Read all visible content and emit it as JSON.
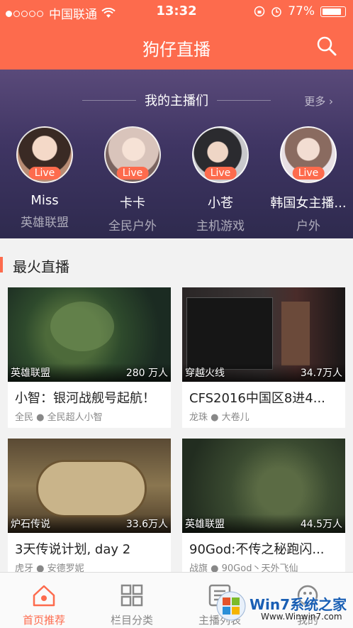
{
  "status_bar": {
    "carrier": "中国联通",
    "time": "13:32",
    "battery": "77%"
  },
  "header": {
    "title": "狗仔直播"
  },
  "my_anchors": {
    "title": "我的主播们",
    "more": "更多",
    "live_label": "Live",
    "items": [
      {
        "name": "Miss",
        "category": "英雄联盟"
      },
      {
        "name": "卡卡",
        "category": "全民户外"
      },
      {
        "name": "小苍",
        "category": "主机游戏"
      },
      {
        "name": "韩国女主播...",
        "category": "户外"
      }
    ]
  },
  "hot": {
    "title": "最火直播",
    "cards": [
      {
        "tag": "英雄联盟",
        "views": "280 万人",
        "title": "小智：银河战舰号起航！",
        "platform": "全民",
        "streamer": "全民超人小智"
      },
      {
        "tag": "穿越火线",
        "views": "34.7万人",
        "title": "CFS2016中国区8进4...",
        "platform": "龙珠",
        "streamer": "大卷儿"
      },
      {
        "tag": "炉石传说",
        "views": "33.6万人",
        "title": "3天传说计划, day 2",
        "platform": "虎牙",
        "streamer": "安德罗妮"
      },
      {
        "tag": "英雄联盟",
        "views": "44.5万人",
        "title": "90God:不传之秘跑闪...",
        "platform": "战旗",
        "streamer": "90God丶天外飞仙"
      }
    ]
  },
  "tabbar": {
    "items": [
      {
        "label": "首页推荐"
      },
      {
        "label": "栏目分类"
      },
      {
        "label": "主播列表"
      },
      {
        "label": "我的"
      }
    ]
  },
  "watermark": {
    "brand": "Win7系统之家",
    "url": "Www.Winwin7.com"
  },
  "colors": {
    "accent": "#fd6b4d",
    "anchor_bg": "#3f3563"
  }
}
